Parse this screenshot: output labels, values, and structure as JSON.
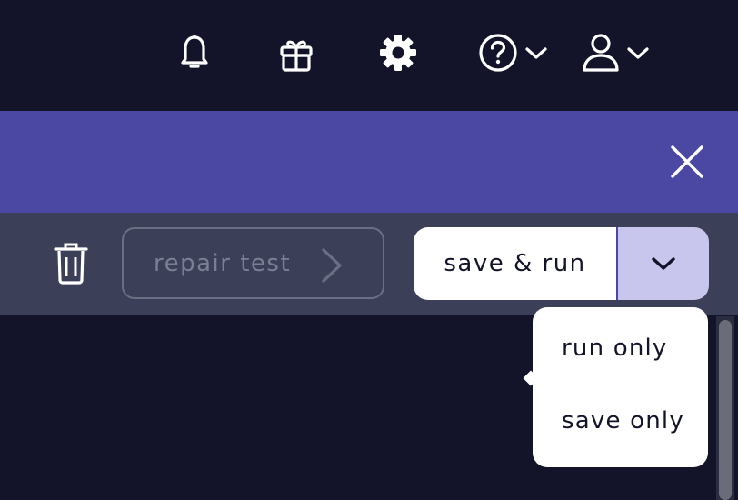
{
  "header": {
    "icons": {
      "notifications": "bell-icon",
      "gifts": "gift-icon",
      "settings": "gear-icon",
      "help": "help-icon",
      "account": "user-icon"
    }
  },
  "banner": {
    "close_icon": "close-icon"
  },
  "toolbar": {
    "delete_icon": "trash-icon",
    "repair_label": "repair test",
    "save_run_label": "save & run",
    "save_options_icon": "chevron-down-icon"
  },
  "save_menu": {
    "items": [
      {
        "label": "run only"
      },
      {
        "label": "save only"
      }
    ]
  },
  "colors": {
    "background": "#13142a",
    "banner": "#4a48a2",
    "toolbar": "#3b3f58",
    "dropdown_toggle": "#c8c6ec"
  }
}
